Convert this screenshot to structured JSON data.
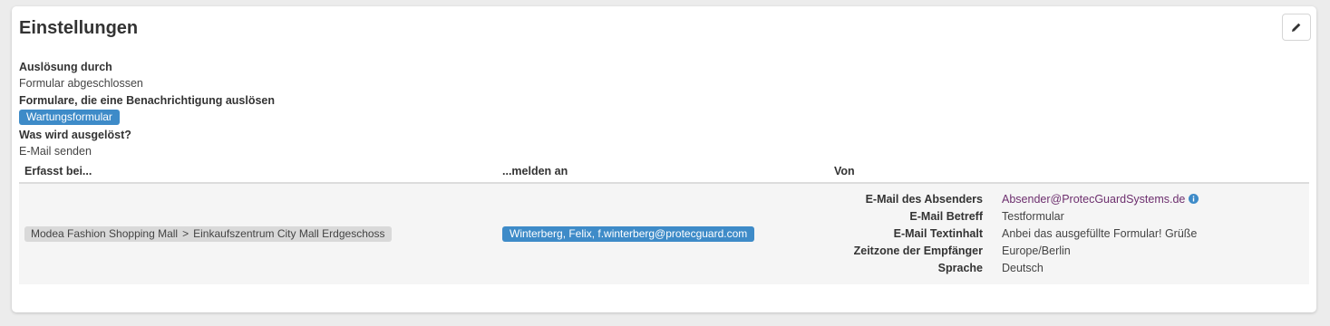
{
  "card": {
    "title": "Einstellungen",
    "edit_icon": "pencil-icon"
  },
  "settings": {
    "trigger_label": "Auslösung durch",
    "trigger_value": "Formular abgeschlossen",
    "forms_label": "Formulare, die eine Benachrichtigung auslösen",
    "forms": [
      "Wartungsformular"
    ],
    "action_label": "Was wird ausgelöst?",
    "action_value": "E-Mail senden"
  },
  "table": {
    "headers": [
      "Erfasst bei...",
      "...melden an",
      "Von"
    ],
    "row": {
      "location": [
        "Modea Fashion Shopping Mall",
        "Einkaufszentrum City Mall Erdgeschoss"
      ],
      "location_separator": ">",
      "recipient": "Winterberg, Felix, f.winterberg@protecguard.com",
      "from": [
        {
          "key": "E-Mail des Absenders",
          "value": "Absender@ProtecGuardSystems.de"
        },
        {
          "key": "E-Mail Betreff",
          "value": "Testformular"
        },
        {
          "key": "E-Mail Textinhalt",
          "value": "Anbei das ausgefüllte Formular! Grüße"
        },
        {
          "key": "Zeitzone der Empfänger",
          "value": "Europe/Berlin"
        },
        {
          "key": "Sprache",
          "value": "Deutsch"
        }
      ]
    }
  },
  "colors": {
    "tag_blue": "#3e8bc8",
    "tag_gray": "#d9d9d9",
    "link_purple": "#6d2f6e",
    "info_icon": "#3e8bc8"
  }
}
